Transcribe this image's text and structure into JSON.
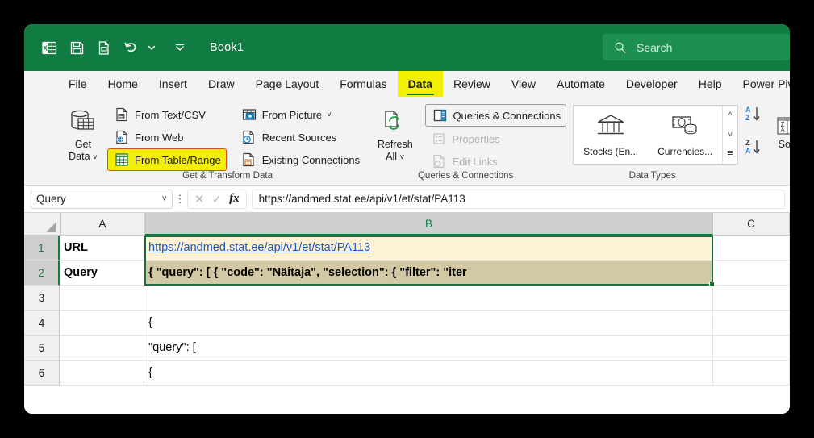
{
  "window": {
    "title": "Book1",
    "quick_access": [
      "excel-logo-icon",
      "save-icon",
      "print-preview-icon",
      "undo-icon",
      "undo-chevron-icon",
      "customize-qat-icon"
    ]
  },
  "search": {
    "placeholder": "Search",
    "icon": "search-icon"
  },
  "tabs": [
    {
      "label": "File",
      "active": false
    },
    {
      "label": "Home",
      "active": false
    },
    {
      "label": "Insert",
      "active": false
    },
    {
      "label": "Draw",
      "active": false
    },
    {
      "label": "Page Layout",
      "active": false
    },
    {
      "label": "Formulas",
      "active": false
    },
    {
      "label": "Data",
      "active": true
    },
    {
      "label": "Review",
      "active": false
    },
    {
      "label": "View",
      "active": false
    },
    {
      "label": "Automate",
      "active": false
    },
    {
      "label": "Developer",
      "active": false
    },
    {
      "label": "Help",
      "active": false
    },
    {
      "label": "Power Pivot",
      "active": false
    }
  ],
  "ribbon": {
    "groups": [
      {
        "label": "Get & Transform Data",
        "big_button": {
          "line1": "Get",
          "line2": "Data",
          "icon": "get-data-icon",
          "has_chevron": true
        },
        "col1": [
          {
            "label": "From Text/CSV",
            "icon": "text-csv-icon",
            "highlighted": false,
            "disabled": false
          },
          {
            "label": "From Web",
            "icon": "web-icon",
            "highlighted": false,
            "disabled": false
          },
          {
            "label": "From Table/Range",
            "icon": "table-range-icon",
            "highlighted": true,
            "disabled": false
          }
        ],
        "col2": [
          {
            "label": "From Picture",
            "icon": "picture-icon",
            "chevron": true,
            "highlighted": false,
            "disabled": false
          },
          {
            "label": "Recent Sources",
            "icon": "recent-sources-icon",
            "highlighted": false,
            "disabled": false
          },
          {
            "label": "Existing Connections",
            "icon": "existing-connections-icon",
            "highlighted": false,
            "disabled": false
          }
        ]
      },
      {
        "label": "Queries & Connections",
        "big_button": {
          "line1": "Refresh",
          "line2": "All",
          "icon": "refresh-all-icon",
          "has_chevron": true
        },
        "col1": [
          {
            "label": "Queries & Connections",
            "icon": "queries-connections-icon",
            "boxed": true,
            "disabled": false
          },
          {
            "label": "Properties",
            "icon": "properties-icon",
            "disabled": true
          },
          {
            "label": "Edit Links",
            "icon": "edit-links-icon",
            "disabled": true
          }
        ]
      },
      {
        "label": "Data Types",
        "items": [
          {
            "label": "Stocks (En...",
            "icon": "stocks-bank-icon"
          },
          {
            "label": "Currencies...",
            "icon": "currencies-icon"
          }
        ],
        "scroll": [
          "scroll-up-icon",
          "scroll-down-icon",
          "gallery-expand-icon"
        ]
      },
      {
        "label": "",
        "sort_buttons": [
          {
            "name": "sort-ascending-icon",
            "label": "A↓Z"
          },
          {
            "name": "sort-descending-icon",
            "label": "Z↓A"
          }
        ],
        "sort_label": "Sort"
      }
    ]
  },
  "formula_bar": {
    "name_box": "Query",
    "name_box_chevron": "chevron-down-icon",
    "cancel_icon": "cancel-icon",
    "enter_icon": "enter-icon",
    "function_icon": "fx",
    "content": "https://andmed.stat.ee/api/v1/et/stat/PA113"
  },
  "grid": {
    "columns": [
      "A",
      "B",
      "C"
    ],
    "selected_column": "B",
    "selected_rows": [
      "1",
      "2"
    ],
    "rows": [
      {
        "num": "1",
        "a": "URL",
        "b": "https://andmed.stat.ee/api/v1/et/stat/PA113",
        "c": "",
        "a_bold": true,
        "b_link": true,
        "selected": true
      },
      {
        "num": "2",
        "a": "Query",
        "b": "{  \"query\": [   {    \"code\": \"Näitaja\",    \"selection\": {     \"filter\": \"iter",
        "c": "",
        "a_bold": true,
        "b_bold": true,
        "selected": true
      },
      {
        "num": "3",
        "a": "",
        "b": "",
        "c": "",
        "selected": false
      },
      {
        "num": "4",
        "a": "",
        "b": "{",
        "c": "",
        "selected": false
      },
      {
        "num": "5",
        "a": "",
        "b": "  \"query\": [",
        "c": "",
        "selected": false
      },
      {
        "num": "6",
        "a": "",
        "b": "   {",
        "c": "",
        "selected": false
      }
    ]
  },
  "colors": {
    "brand_green": "#107c41",
    "highlight_yellow": "#f2f000",
    "highlight_outline": "#d94f1e",
    "selection_border": "#1d6b3f",
    "link_blue": "#1a57c8"
  }
}
